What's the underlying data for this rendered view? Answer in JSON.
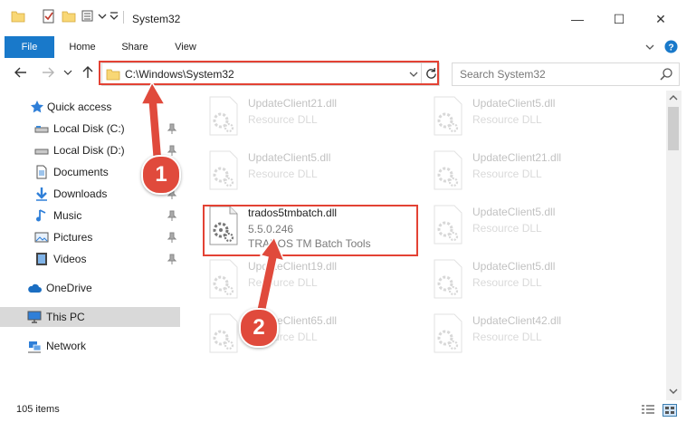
{
  "window": {
    "title": "System32",
    "controls": {
      "minimize": "—",
      "maximize": "☐",
      "close": "✕"
    }
  },
  "ribbon": {
    "tabs": [
      "File",
      "Home",
      "Share",
      "View"
    ]
  },
  "address": {
    "path": "C:\\Windows\\System32",
    "search_placeholder": "Search System32"
  },
  "sidebar": {
    "items": [
      {
        "label": "Quick access",
        "icon": "star-icon",
        "pinned": false
      },
      {
        "label": "Local Disk (C:)",
        "icon": "drive-icon",
        "pinned": true
      },
      {
        "label": "Local Disk (D:)",
        "icon": "drive-icon",
        "pinned": true
      },
      {
        "label": "Documents",
        "icon": "document-icon",
        "pinned": true
      },
      {
        "label": "Downloads",
        "icon": "download-icon",
        "pinned": true
      },
      {
        "label": "Music",
        "icon": "music-icon",
        "pinned": true
      },
      {
        "label": "Pictures",
        "icon": "pictures-icon",
        "pinned": true
      },
      {
        "label": "Videos",
        "icon": "videos-icon",
        "pinned": true
      },
      {
        "label": "OneDrive",
        "icon": "cloud-icon",
        "pinned": false
      },
      {
        "label": "This PC",
        "icon": "computer-icon",
        "pinned": false,
        "selected": true
      },
      {
        "label": "Network",
        "icon": "network-icon",
        "pinned": false
      }
    ]
  },
  "files": [
    {
      "name": "UpdateClient21.dll",
      "type": "Resource DLL",
      "faded": true
    },
    {
      "name": "UpdateClient5.dll",
      "type": "Resource DLL",
      "faded": true
    },
    {
      "name": "UpdateClient5.dll",
      "type": "Resource DLL",
      "faded": true
    },
    {
      "name": "UpdateClient21.dll",
      "type": "Resource DLL",
      "faded": true
    },
    {
      "name": "trados5tmbatch.dll",
      "type": "5.5.0.246",
      "description": "TRADOS TM Batch Tools",
      "faded": false
    },
    {
      "name": "UpdateClient5.dll",
      "type": "Resource DLL",
      "faded": true
    },
    {
      "name": "UpdateClient19.dll",
      "type": "Resource DLL",
      "faded": true
    },
    {
      "name": "UpdateClient5.dll",
      "type": "Resource DLL",
      "faded": true
    },
    {
      "name": "UpdateClient65.dll",
      "type": "Resource DLL",
      "faded": true
    },
    {
      "name": "UpdateClient42.dll",
      "type": "Resource DLL",
      "faded": true
    }
  ],
  "status": {
    "item_count": "105 items"
  },
  "annotations": {
    "step1": "1",
    "step2": "2",
    "highlight_color": "#e34234",
    "badge_color": "#e04a3c"
  },
  "colors": {
    "file_tab": "#1979ca",
    "selected_nav": "#d9d9d9",
    "folder": "#f8d775"
  }
}
